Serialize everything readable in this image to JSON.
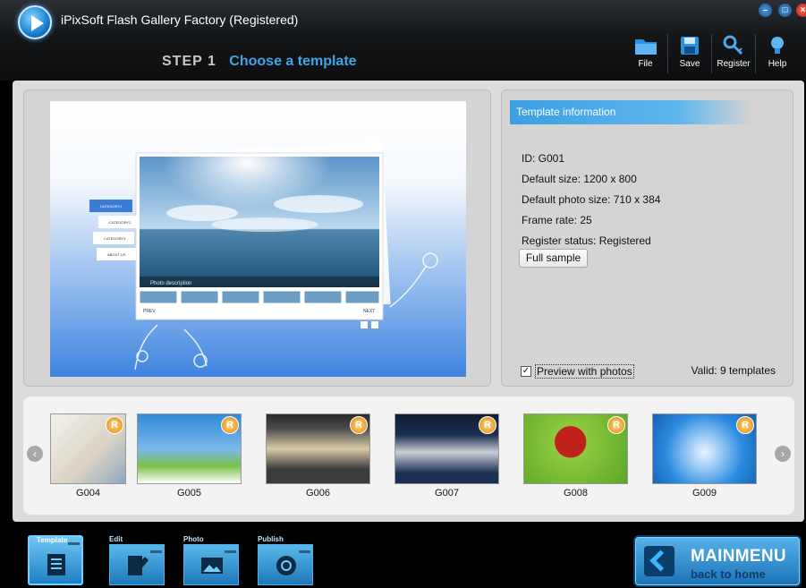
{
  "window": {
    "title": "iPixSoft Flash Gallery Factory (Registered)"
  },
  "step": {
    "number": "STEP 1",
    "title": "Choose a template"
  },
  "toolbar": [
    {
      "label": "File",
      "icon": "folder-icon"
    },
    {
      "label": "Save",
      "icon": "save-icon"
    },
    {
      "label": "Register",
      "icon": "key-icon"
    },
    {
      "label": "Help",
      "icon": "lightbulb-icon"
    }
  ],
  "preview": {
    "categories": [
      "CATEGORY1",
      "CATEGORY2",
      "CATEGORY3",
      "ABOUT US"
    ],
    "photo_caption": "Photo description",
    "prev_label": "PREV",
    "next_label": "NEXT"
  },
  "template_info": {
    "header": "Template information",
    "lines": [
      "ID: G001",
      "Default size: 1200 x 800",
      "Default photo size: 710 x 384",
      "Frame rate: 25",
      "Register status: Registered"
    ],
    "full_sample_label": "Full sample",
    "preview_with_photos_label": "Preview with photos",
    "preview_with_photos_checked": true,
    "valid_label": "Valid: 9 templates"
  },
  "templates": [
    {
      "id": "G004",
      "colors": [
        "#e8e6df",
        "#6f9fc5"
      ]
    },
    {
      "id": "G005",
      "colors": [
        "#2f8ad8",
        "#7bc24a"
      ]
    },
    {
      "id": "G006",
      "colors": [
        "#3b3b3b",
        "#d8c9a8"
      ]
    },
    {
      "id": "G007",
      "colors": [
        "#1b2f52",
        "#c9cfd6"
      ]
    },
    {
      "id": "G008",
      "colors": [
        "#8ec83c",
        "#c0201e"
      ]
    },
    {
      "id": "G009",
      "colors": [
        "#2b8be0",
        "#eaf4ff"
      ]
    }
  ],
  "bottom_tabs": [
    {
      "label": "Template",
      "active": true
    },
    {
      "label": "Edit",
      "active": false
    },
    {
      "label": "Photo",
      "active": false
    },
    {
      "label": "Publish",
      "active": false
    }
  ],
  "mainmenu": {
    "title": "MAINMENU",
    "subtitle": "back to home"
  },
  "colors": {
    "accent": "#3fa6e6",
    "panel": "#dcdcdc",
    "titlebar": "#141618"
  }
}
